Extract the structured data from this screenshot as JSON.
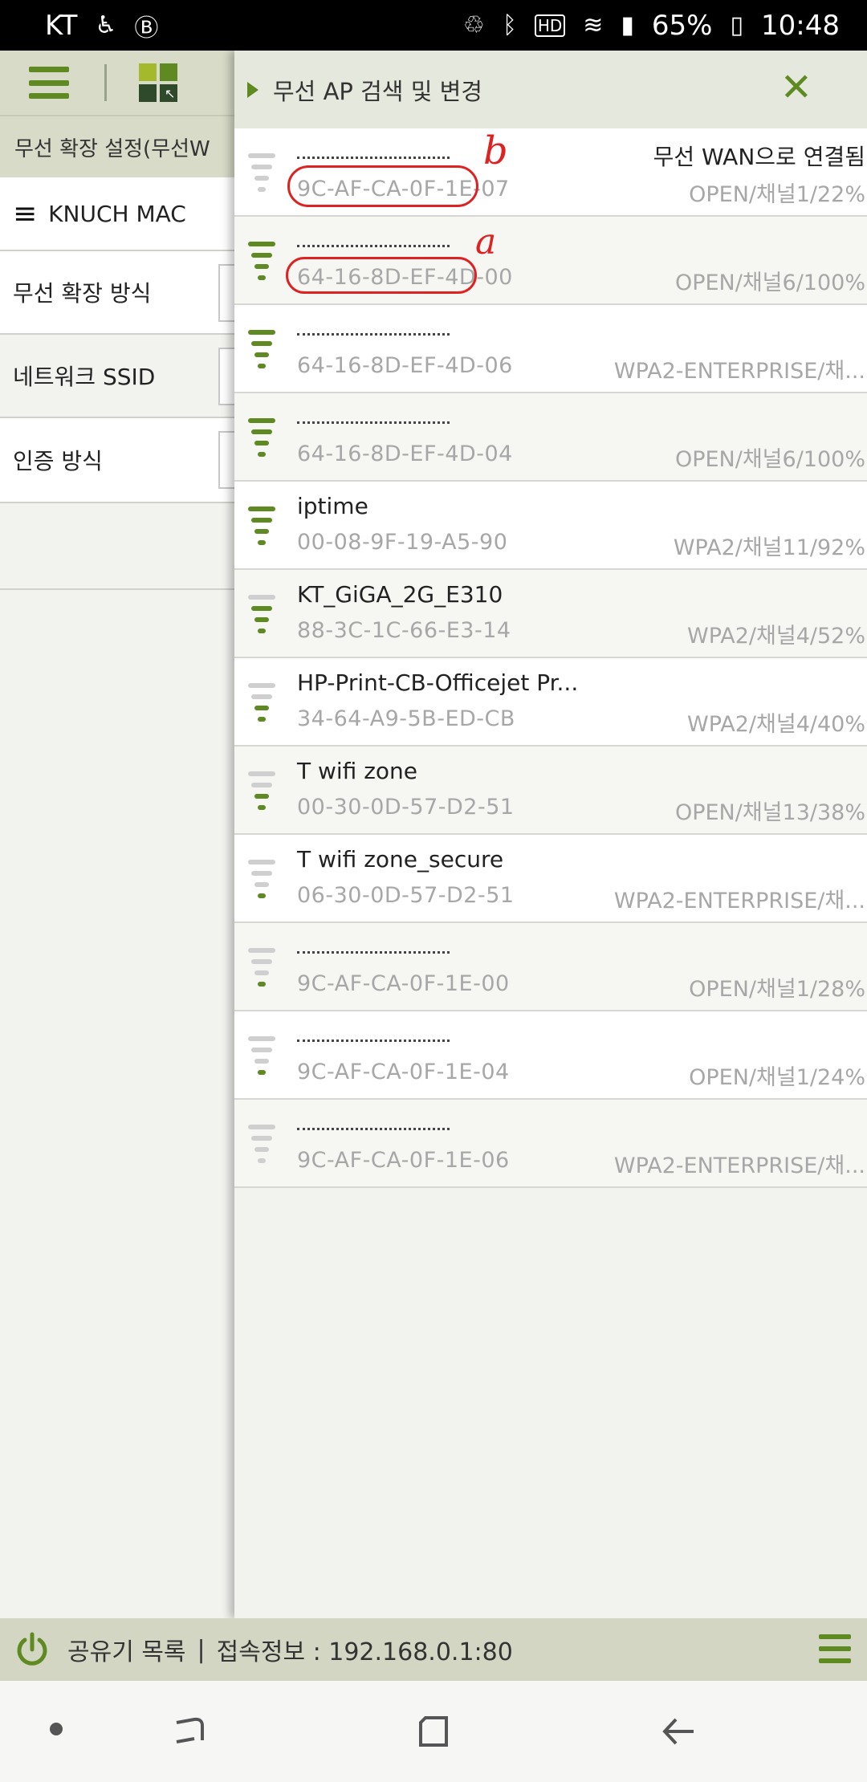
{
  "status_bar": {
    "carrier": "KT",
    "battery": "65%",
    "time": "10:48"
  },
  "base_page": {
    "section_title": "무선 확장 설정(무선W",
    "network_label": "KNUCH MAC",
    "rows": [
      {
        "label": "무선 확장 방식"
      },
      {
        "label": "네트워크 SSID"
      },
      {
        "label": "인증 방식"
      }
    ]
  },
  "panel": {
    "title": "무선 AP 검색 및 변경",
    "ap_list": [
      {
        "name": "",
        "status": "무선 WAN으로 연결됨",
        "mac": "9C-AF-CA-0F-1E-07",
        "info": "OPEN/채널1/22%",
        "level": 0,
        "redacted": true
      },
      {
        "name": "",
        "status": "",
        "mac": "64-16-8D-EF-4D-00",
        "info": "OPEN/채널6/100%",
        "level": 4,
        "redacted": true
      },
      {
        "name": "",
        "status": "",
        "mac": "64-16-8D-EF-4D-06",
        "info": "WPA2-ENTERPRISE/채...",
        "level": 4,
        "redacted": true
      },
      {
        "name": "",
        "status": "",
        "mac": "64-16-8D-EF-4D-04",
        "info": "OPEN/채널6/100%",
        "level": 4,
        "redacted": true
      },
      {
        "name": "iptime",
        "status": "",
        "mac": "00-08-9F-19-A5-90",
        "info": "WPA2/채널11/92%",
        "level": 4,
        "redacted": false
      },
      {
        "name": "KT_GiGA_2G_E310",
        "status": "",
        "mac": "88-3C-1C-66-E3-14",
        "info": "WPA2/채널4/52%",
        "level": 3,
        "redacted": false
      },
      {
        "name": "HP-Print-CB-Officejet Pr...",
        "status": "",
        "mac": "34-64-A9-5B-ED-CB",
        "info": "WPA2/채널4/40%",
        "level": 2,
        "redacted": false
      },
      {
        "name": "T wifi zone",
        "status": "",
        "mac": "00-30-0D-57-D2-51",
        "info": "OPEN/채널13/38%",
        "level": 2,
        "redacted": false
      },
      {
        "name": "T wifi zone_secure",
        "status": "",
        "mac": "06-30-0D-57-D2-51",
        "info": "WPA2-ENTERPRISE/채...",
        "level": 1,
        "redacted": false
      },
      {
        "name": "",
        "status": "",
        "mac": "9C-AF-CA-0F-1E-00",
        "info": "OPEN/채널1/28%",
        "level": 1,
        "redacted": true
      },
      {
        "name": "",
        "status": "",
        "mac": "9C-AF-CA-0F-1E-04",
        "info": "OPEN/채널1/24%",
        "level": 1,
        "redacted": true
      },
      {
        "name": "",
        "status": "",
        "mac": "9C-AF-CA-0F-1E-06",
        "info": "WPA2-ENTERPRISE/채...",
        "level": 0,
        "redacted": true
      }
    ]
  },
  "annotations": {
    "label_a": "a",
    "label_b": "b"
  },
  "bottom_bar": {
    "router_list": "공유기 목록",
    "separator": "|",
    "connection_info": "접속정보 : 192.168.0.1:80"
  },
  "colors": {
    "accent_green": "#5f8a22",
    "signal_inactive": "#cfcfcf",
    "annotation_red": "#dd2222"
  }
}
